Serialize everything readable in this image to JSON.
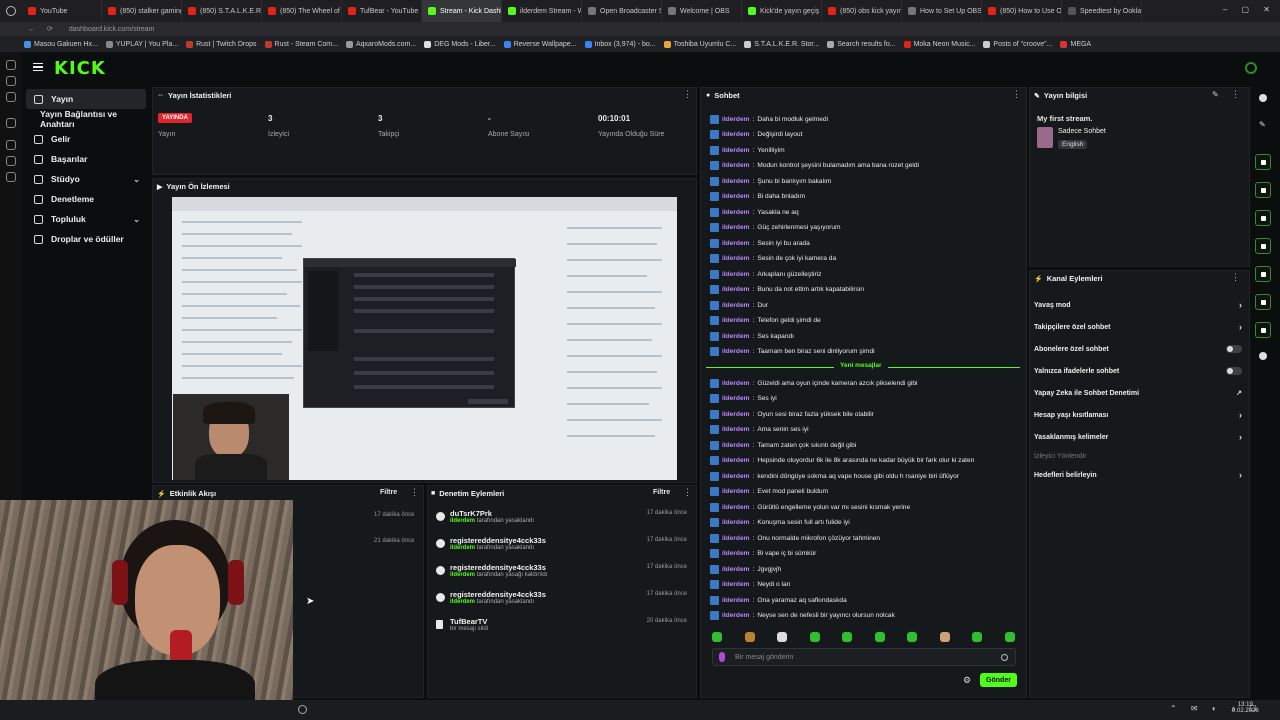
{
  "browser": {
    "tabs": [
      "YouTube",
      "(850) stalker gaming",
      "(850) S.T.A.L.K.E.R",
      "(850) The Wheel of",
      "TufBear - YouTube",
      "Stream - Kick Dashb",
      "ilderdem Stream - W",
      "Open Broadcaster S",
      "Welcome | OBS",
      "Kick'de yayın geçiş",
      "(850) obs kick yayın",
      "How to Set Up OBS",
      "(850) How to Use O",
      "Speedtest by Ookla"
    ],
    "active_tab": 5,
    "url": "dashboard.kick.com/stream",
    "bookmarks": [
      "Masou Gakuen Hx...",
      "YUPLAY | You Pla...",
      "Rust | Twitch Drops",
      "Rust - Steam Com...",
      "AqxaroMods.com...",
      "DEG Mods - Liber...",
      "Reverse Wallpape...",
      "Inbox (3,974) - bo...",
      "Toshiba Uyumlu C...",
      "S.T.A.L.K.E.R. Stor...",
      "Search results fo...",
      "Moka Neon Music...",
      "Posts of \"croove\"...",
      "MEGA"
    ]
  },
  "brand": {
    "logo": "KICK",
    "accent": "#53fc18"
  },
  "nav": {
    "items": [
      {
        "label": "Yayın"
      },
      {
        "label": "Yayın Bağlantısı ve Anahtarı"
      },
      {
        "label": "Gelir"
      },
      {
        "label": "Başarılar"
      },
      {
        "label": "Stüdyo"
      },
      {
        "label": "Denetleme"
      },
      {
        "label": "Topluluk"
      },
      {
        "label": "Droplar ve ödüller"
      }
    ]
  },
  "stats": {
    "title": "Yayın İstatistikleri",
    "live_badge": "YAYINDA",
    "items": [
      {
        "value": "",
        "label": "Yayın"
      },
      {
        "value": "3",
        "label": "İzleyici"
      },
      {
        "value": "3",
        "label": "Takipçi"
      },
      {
        "value": "-",
        "label": "Abone Sayısı"
      },
      {
        "value": "00:10:01",
        "label": "Yayında Olduğu Süre"
      }
    ]
  },
  "preview": {
    "title": "Yayın Ön İzlemesi"
  },
  "activity": {
    "title": "Etkinlik Akışı",
    "filter": "Filtre",
    "times": [
      "17 dakika önce",
      "21 dakika önce"
    ]
  },
  "moderation": {
    "title": "Denetim Eylemleri",
    "filter": "Filtre",
    "rows": [
      {
        "name": "duTsrK7Prk",
        "actor": "ilderdem",
        "action": "tarafından yasaklandı",
        "time": "17 dakika önce"
      },
      {
        "name": "registereddensitye4cck33s",
        "actor": "ilderdem",
        "action": "tarafından yasaklandı",
        "time": "17 dakika önce"
      },
      {
        "name": "registereddensitye4cck33s",
        "actor": "ilderdem",
        "action": "tarafından yasağı kaldırıldı",
        "time": "17 dakika önce"
      },
      {
        "name": "registereddensitye4cck33s",
        "actor": "ilderdem",
        "action": "tarafından yasaklandı",
        "time": "17 dakika önce"
      },
      {
        "name": "TufBearTV",
        "actor": "",
        "action": "bir mesajı sildi",
        "time": "20 dakika önce"
      }
    ]
  },
  "chat": {
    "title": "Sohbet",
    "new_messages_label": "Yeni mesajlar",
    "user": "ilderdem",
    "messages_before": [
      "Daha bi modluk gelmedi",
      "Değişirdi layout",
      "Yenilliyim",
      "Modun kontrol şeysini bulamadım ama bana rozet geldi",
      "Şunu bi banlıyım bakalım",
      "Bi daha bnladım",
      "Yasakla ne aq",
      "Güç zehirlenmesi yaşıyorum",
      "Sesin iyi bu arada",
      "Sesin de çok iyi kamera da",
      "Arkaplanı güzelleştiriz",
      "Bunu da not ettim artık kapatabilirsin",
      "Dur",
      "Telefon geldi şimdi de",
      "Ses kapandı",
      "Taamam ben biraz seni dinliyorum şimdi"
    ],
    "messages_after": [
      "Güzeldi ama oyun içinde kameran azcık pikselendi gibi",
      "Ses iyi",
      "Oyun sesi biraz fazla yüksek bile olabilir",
      "Ama senin ses iyi",
      "Tamam zaten çok sıkıntı değil gibi",
      "Hepsinde oluyordur 6k ile 8k arasında ne kadar büyük bir fark olur ki zaten",
      "kendini döngüye sokma aq vape house gibi oldu h rsaniye biri üflüyor",
      "Evet mod paneli buldum",
      "Gürültü engelleme yolun var mı sesini kısmak yerine",
      "Konuşma sesin full artı fulide iyi",
      "Onu normalde mikrofon çözüyor tahminen",
      "Bi vape iç bi sümkür",
      "Jgvgjvjh",
      "Neydi o lan",
      "Ona yaramaz aq safkındaskda",
      "Neyse sen de nefesli bir yayıncı olursun nolcak"
    ],
    "input_placeholder": "Bir mesaj gönderin",
    "send_label": "Gönder"
  },
  "info": {
    "title": "Yayın bilgisi",
    "stream_title": "My first stream.",
    "category": "Sadece Sohbet",
    "language": "English"
  },
  "channel_actions": {
    "title": "Kanal Eylemleri",
    "items": [
      {
        "label": "Yavaş mod",
        "control": "arrow"
      },
      {
        "label": "Takipçilere özel sohbet",
        "control": "arrow"
      },
      {
        "label": "Abonelere özel sohbet",
        "control": "toggle"
      },
      {
        "label": "Yalnızca ifadelerle sohbet",
        "control": "toggle"
      },
      {
        "label": "Yapay Zeka ile Sohbet Denetimi",
        "control": "external"
      },
      {
        "label": "Hesap yaşı kısıtlaması",
        "control": "arrow"
      },
      {
        "label": "Yasaklanmış kelimeler",
        "control": "arrow"
      },
      {
        "label": "İzleyici Yönlendir",
        "control": "none"
      },
      {
        "label": "Hedefleri belirleyin",
        "control": "arrow"
      }
    ]
  },
  "taskbar": {
    "time": "13:19",
    "date": "9.02.2026"
  }
}
